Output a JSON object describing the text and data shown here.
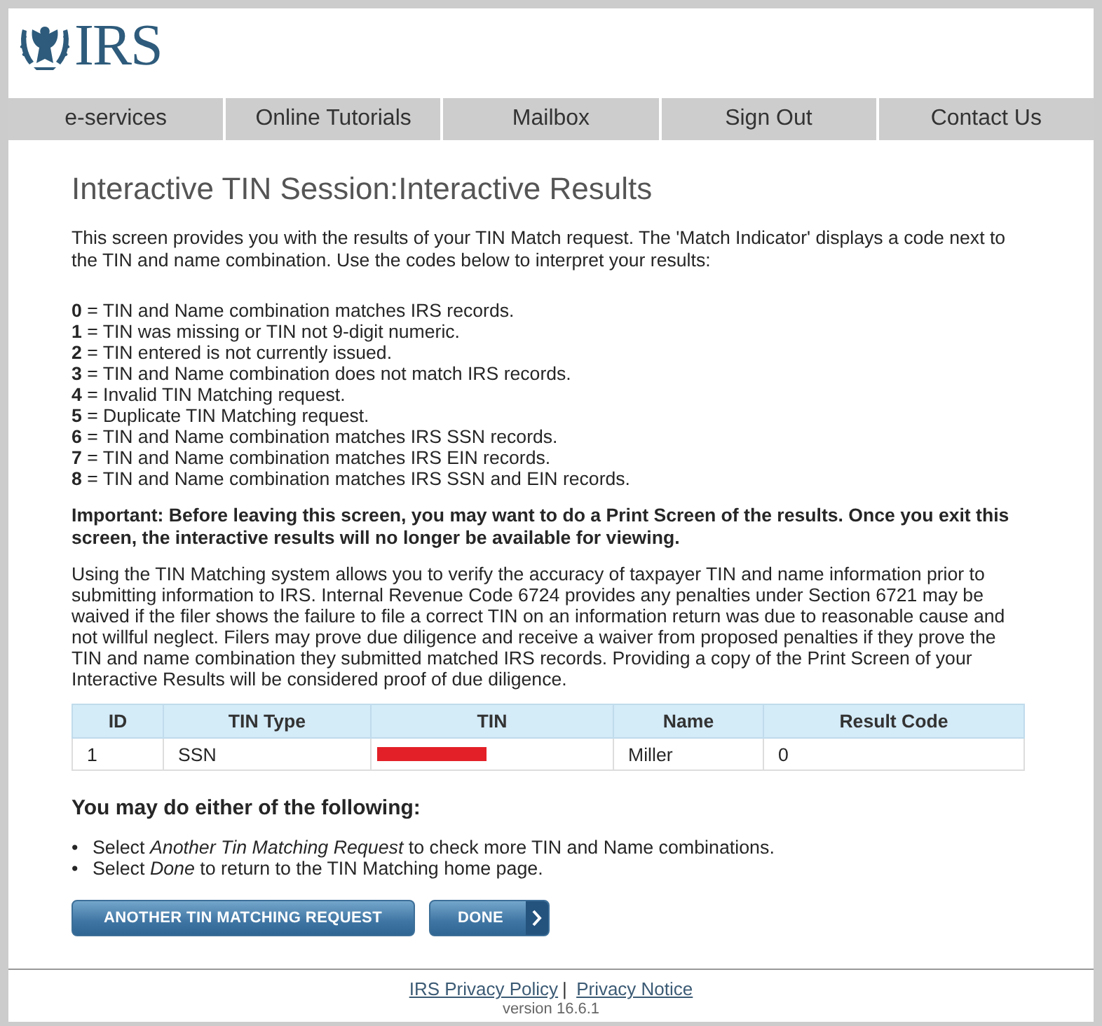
{
  "logo": {
    "text": "IRS"
  },
  "nav": [
    "e-services",
    "Online Tutorials",
    "Mailbox",
    "Sign Out",
    "Contact Us"
  ],
  "title": "Interactive TIN Session:Interactive Results",
  "intro": "This screen provides you with the results of your TIN Match request. The 'Match Indicator' displays a code next to the TIN and name combination. Use the codes below to interpret your results:",
  "codes": [
    "**0** = TIN and Name combination matches IRS records.",
    "**1** = TIN was missing or TIN not 9-digit numeric.",
    "**2** = TIN entered is not currently issued.",
    "**3** = TIN and Name combination does not match IRS records.",
    "**4** = Invalid TIN Matching request.",
    "**5** = Duplicate TIN Matching request.",
    "**6** = TIN and Name combination matches IRS SSN records.",
    "**7** = TIN and Name combination matches IRS EIN records.",
    "**8** = TIN and Name combination matches IRS SSN and EIN records."
  ],
  "important": "Important: Before leaving this screen, you may want to do a Print Screen of the results. Once you exit this screen, the interactive results will no longer be available for viewing.",
  "info": "Using the TIN Matching system allows you to verify the accuracy of taxpayer TIN and name information prior to submitting information to IRS. Internal Revenue Code 6724 provides any penalties under Section 6721 may be waived if the filer shows the failure to file a correct TIN on an information return was due to reasonable cause and not willful neglect. Filers may prove due diligence and receive a waiver from proposed penalties if they prove the TIN and name combination they submitted matched IRS records. Providing a copy of the Print Screen of your Interactive Results will be considered proof of due diligence.",
  "table": {
    "columns": [
      "ID",
      "TIN Type",
      "TIN",
      "Name",
      "Result Code"
    ],
    "rows": [
      {
        "id": "1",
        "tin_type": "SSN",
        "tin_redacted": true,
        "name": "Miller",
        "result_code": "0"
      }
    ]
  },
  "options": {
    "heading": "You may do either of the following:",
    "items": [
      {
        "bullet": "•",
        "text": "Select *Another Tin Matching Request* to check more TIN and Name combinations."
      },
      {
        "bullet": "•",
        "text": "Select *Done* to return to the TIN Matching home page."
      }
    ]
  },
  "buttons": [
    {
      "label": "ANOTHER TIN MATCHING REQUEST",
      "kind": "plain"
    },
    {
      "label": "DONE",
      "kind": "next"
    }
  ],
  "footer": {
    "links": [
      "IRS Privacy Policy",
      "Privacy Notice"
    ],
    "separator": "|",
    "version": "version 16.6.1"
  }
}
